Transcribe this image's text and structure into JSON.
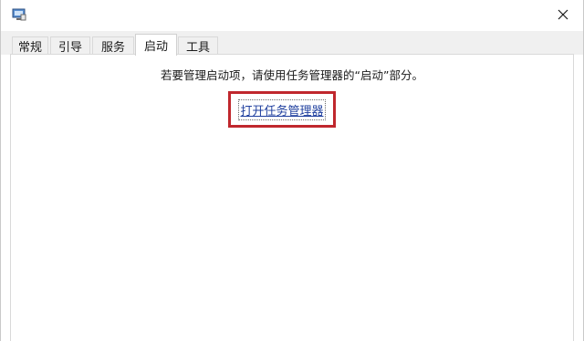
{
  "tabs": [
    {
      "label": "常规"
    },
    {
      "label": "引导"
    },
    {
      "label": "服务"
    },
    {
      "label": "启动"
    },
    {
      "label": "工具"
    }
  ],
  "active_tab": "启动",
  "startup": {
    "info_text": "若要管理启动项，请使用任务管理器的“启动”部分。",
    "open_task_manager_link": "打开任务管理器"
  },
  "colors": {
    "highlight_box": "#c0272d",
    "link": "#1f3f9e"
  },
  "icons": {
    "app": "system-configuration-icon",
    "close": "close-icon"
  }
}
